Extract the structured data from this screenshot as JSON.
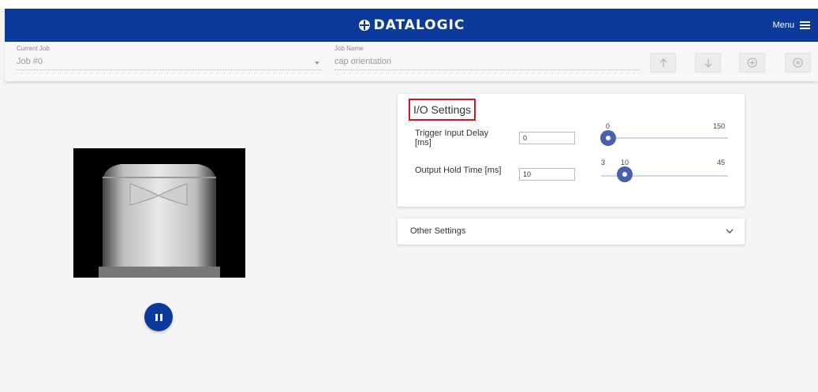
{
  "header": {
    "brand": "DATALOGIC",
    "menu_label": "Menu"
  },
  "jobbar": {
    "current_job_label": "Current Job",
    "current_job_value": "Job #0",
    "job_name_label": "Job Name",
    "job_name_value": "cap orientation",
    "buttons": [
      "arrow-up-icon",
      "arrow-down-icon",
      "add-circle-icon",
      "close-circle-icon"
    ]
  },
  "camera": {
    "state": "running",
    "control": "pause"
  },
  "io_settings": {
    "title": "I/O Settings",
    "trigger_delay": {
      "label": "Trigger Input Delay [ms]",
      "value": "0",
      "min": "0",
      "max": "150",
      "current": "0"
    },
    "output_hold": {
      "label": "Output Hold Time [ms]",
      "value": "10",
      "min": "3",
      "max": "45",
      "current": "10"
    }
  },
  "other_settings": {
    "label": "Other Settings"
  },
  "colors": {
    "brand": "#0c3a9a",
    "slider": "#4a5fae",
    "highlight": "#e0151c"
  }
}
